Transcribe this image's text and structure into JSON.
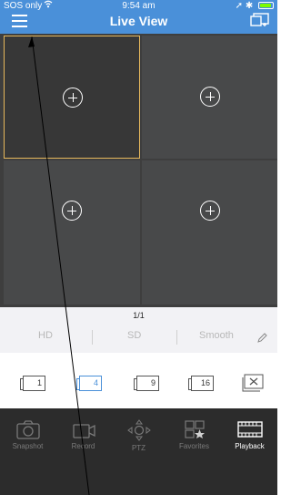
{
  "status_bar": {
    "carrier": "SOS only",
    "time": "9:54 am"
  },
  "header": {
    "title": "Live View"
  },
  "info": {
    "page": "1/1",
    "quality": [
      "HD",
      "SD",
      "Smooth"
    ]
  },
  "layouts": [
    "1",
    "4",
    "9",
    "16"
  ],
  "tabs": [
    {
      "label": "Snapshot"
    },
    {
      "label": "Record"
    },
    {
      "label": "PTZ"
    },
    {
      "label": "Favorites"
    },
    {
      "label": "Playback"
    }
  ],
  "colors": {
    "header_blue": "#4a90d9",
    "selected_border": "#e6b85c",
    "tabbar_bg": "#2c2c2c"
  }
}
